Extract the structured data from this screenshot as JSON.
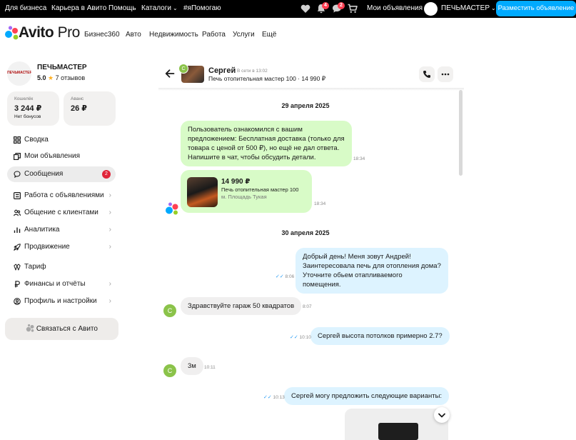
{
  "topbar": {
    "links": [
      "Для бизнеса",
      "Карьера в Авито",
      "Помощь"
    ],
    "catalogs": "Каталоги",
    "hashtag": "#яПомогаю",
    "notif_badge": "4",
    "msg_badge": "2",
    "my_ads": "Мои объявления",
    "shop_name": "ПЕЧЬМАСТЕР",
    "place_ad": "Разместить объявление",
    "icons": [
      "heart-icon",
      "bell-icon",
      "chat-icon",
      "cart-icon"
    ]
  },
  "brand": {
    "logo_main": "Avito",
    "logo_pro": " Pro",
    "colors": [
      "#00aaff",
      "#ff4053",
      "#97cf26",
      "#a169f7"
    ]
  },
  "nav2": [
    "Бизнес360",
    "Авто",
    "Недвижимость",
    "Работа",
    "Услуги",
    "Ещё"
  ],
  "profile": {
    "logo_text": "ПЕЧЬМАСТЕР",
    "name": "ПЕЧЬМАСТЕР",
    "rating": "5.0",
    "reviews": "7 отзывов"
  },
  "wallet": {
    "title": "Кошелёк",
    "value": "3 244 ₽",
    "sub": "Нет бонусов"
  },
  "advance": {
    "title": "Аванс",
    "value": "26 ₽"
  },
  "menu": [
    {
      "label": "Сводка",
      "icon": "grid-icon"
    },
    {
      "label": "Мои объявления",
      "icon": "ads-icon"
    },
    {
      "label": "Сообщения",
      "icon": "message-icon",
      "badge": "2",
      "active": true
    },
    {
      "label": "Работа с объявлениями",
      "icon": "list-icon",
      "chevron": true
    },
    {
      "label": "Общение с клиентами",
      "icon": "users-icon",
      "chevron": true
    },
    {
      "label": "Аналитика",
      "icon": "chart-icon",
      "chevron": true
    },
    {
      "label": "Продвижение",
      "icon": "rocket-icon",
      "chevron": true
    },
    {
      "label": "Тариф",
      "icon": "tariff-icon"
    },
    {
      "label": "Финансы и отчёты",
      "icon": "ruble-icon",
      "chevron": true
    },
    {
      "label": "Профиль и настройки",
      "icon": "settings-icon",
      "chevron": true
    }
  ],
  "contact_button": "Связаться с Авито",
  "chat": {
    "peer_initial": "С",
    "peer_name": "Сергей",
    "peer_status": "В сети в 13:02",
    "item_line": "Печь отопительная мастер 100 · 14 990 ₽",
    "dates": [
      "29 апреля 2025",
      "30 апреля 2025"
    ],
    "messages": [
      {
        "text": "Пользователь ознакомился с вашим предложением: Бесплатная доставка (только для товара с ценой от 500 ₽), но ещё не дал ответа. Напишите в чат, чтобы обсудить детали.",
        "time": "18:34"
      },
      {
        "offer_price": "14 990 ₽",
        "offer_title": "Печь отопительная мастер 100",
        "offer_metro": "м. Площадь Тукая",
        "time": "18:34"
      },
      {
        "text": "Добрый день! Меня зовут Андрей! Заинтересовала печь для отопления дома? Уточните обьем отапливаемого помещения.",
        "time": "8:06"
      },
      {
        "text": "Здравствуйте гараж 50 квадратов",
        "time": "8:07"
      },
      {
        "text": "Сергей высота потолков примерно 2.7?",
        "time": "10:10"
      },
      {
        "text": "3м",
        "time": "10:11"
      },
      {
        "text": "Сергей могу предложить следующие варианты:",
        "time": "10:13"
      }
    ]
  }
}
